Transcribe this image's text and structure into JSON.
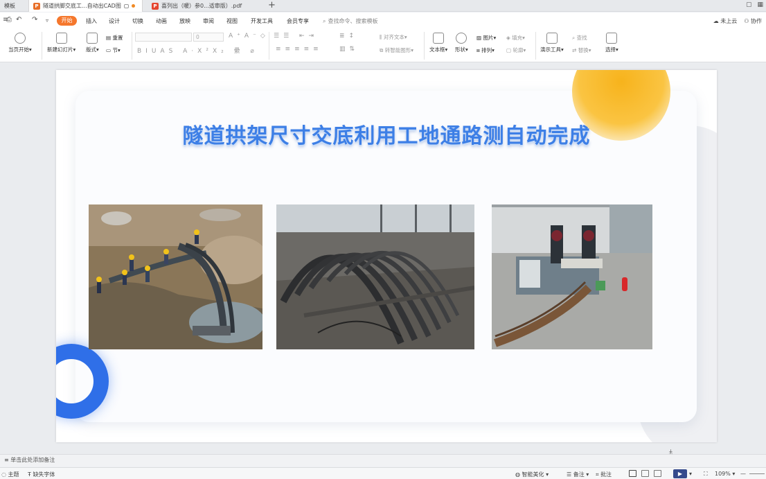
{
  "tabs": [
    {
      "label": "模板"
    },
    {
      "label": "隧道拱脚交底工...自动出CAD图"
    },
    {
      "label": "喜列出（暖）参0...适审版）.pdf"
    }
  ],
  "menu": {
    "home": "开始",
    "items": [
      "插入",
      "设计",
      "切换",
      "动画",
      "放映",
      "审阅",
      "视图",
      "开发工具",
      "会员专享"
    ],
    "search_placeholder": "查找命令、搜索模板",
    "cloud": "未上云",
    "collab": "协作"
  },
  "ribbon": {
    "play_from_current": "当页开始",
    "new_slide": "新建幻灯片",
    "layout": "版式",
    "section": "节",
    "reset": "重置",
    "font_size": "0",
    "align_text": "对齐文本",
    "convert_smartart": "转智能图形",
    "textbox": "文本框",
    "shape": "形状",
    "picture": "图片",
    "arrange": "排列",
    "fill": "填充",
    "outline": "轮廓",
    "present_tools": "演示工具",
    "find": "查找",
    "replace": "替换",
    "select": "选择"
  },
  "slide": {
    "title": "隧道拱架尺寸交底利用工地通路测自动完成"
  },
  "notes": {
    "placeholder": "单击此处添加备注"
  },
  "status": {
    "theme": "主题",
    "missing_font": "缺失字体",
    "beautify": "智能美化",
    "notes_btn": "备注",
    "comment_btn": "批注",
    "zoom": "109%"
  },
  "colors": {
    "accent": "#f5772c",
    "title_blue": "#3d7fe6",
    "ring_blue": "#2f6fe8",
    "blob_yellow": "#f7b31c"
  }
}
